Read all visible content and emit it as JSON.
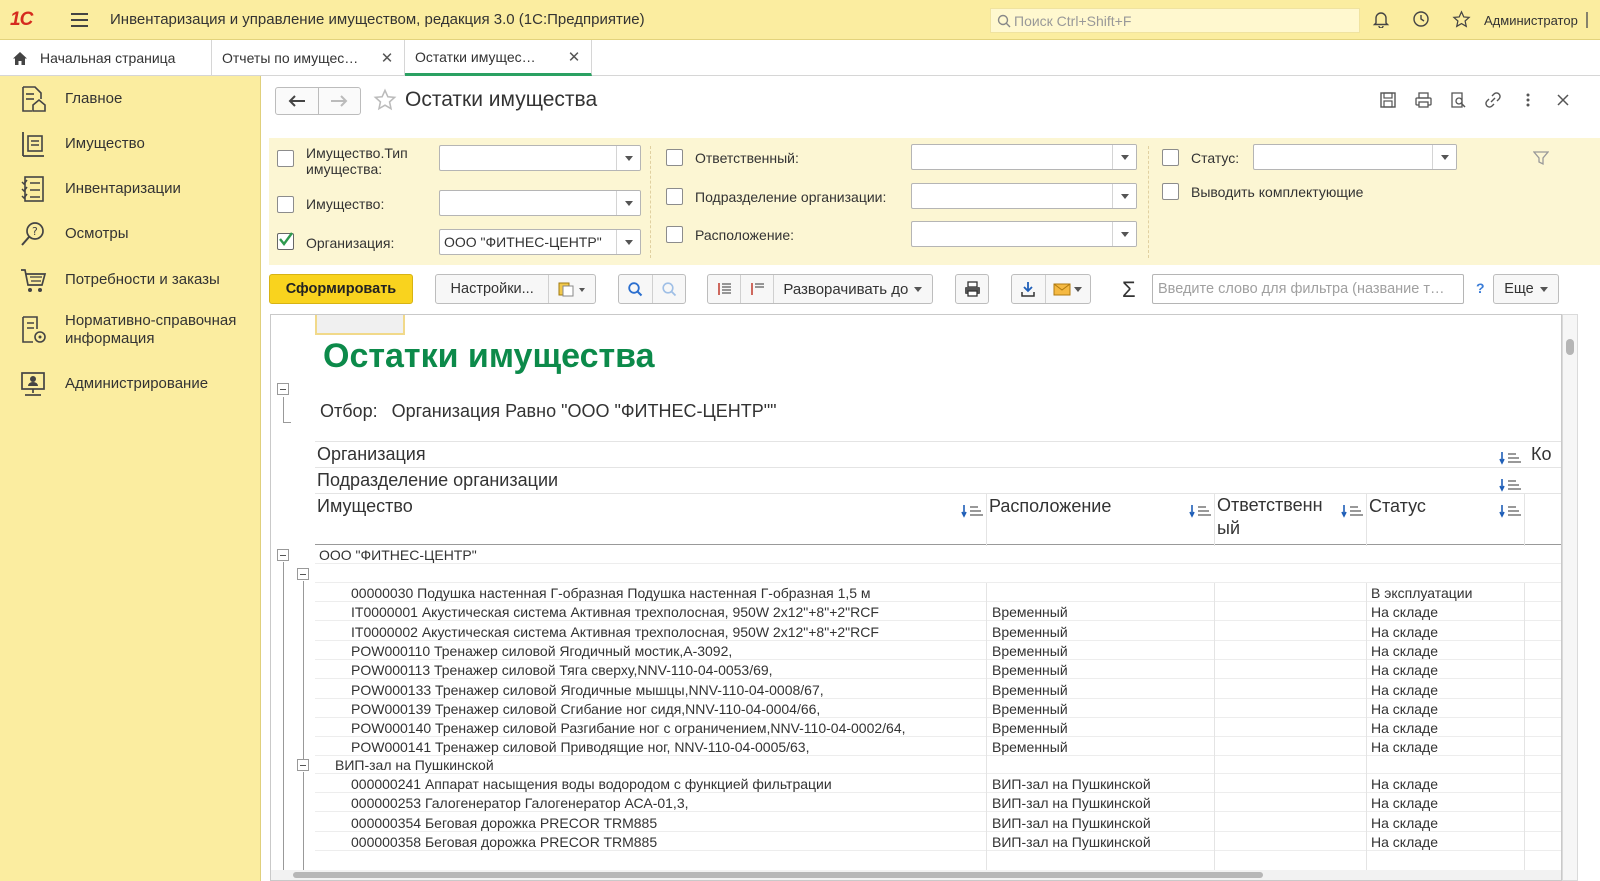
{
  "app": {
    "title": "Инвентаризация и управление имуществом, редакция 3.0  (1С:Предприятие)",
    "logo": "1С",
    "search_placeholder": "Поиск Ctrl+Shift+F",
    "user": "Администратор"
  },
  "tabs": [
    {
      "label": "Начальная страница"
    },
    {
      "label": "Отчеты по имущес…"
    },
    {
      "label": "Остатки имущес…"
    }
  ],
  "sidebar": {
    "items": [
      {
        "label": "Главное",
        "icon": "home-doc-icon"
      },
      {
        "label": "Имущество",
        "icon": "asset-icon"
      },
      {
        "label": "Инвентаризации",
        "icon": "checklist-icon"
      },
      {
        "label": "Осмотры",
        "icon": "inspection-icon"
      },
      {
        "label": "Потребности и заказы",
        "icon": "cart-icon"
      },
      {
        "label": "Нормативно-справочная информация",
        "icon": "reference-icon"
      },
      {
        "label": "Администрирование",
        "icon": "admin-icon"
      }
    ]
  },
  "form": {
    "title": "Остатки имущества"
  },
  "filters": {
    "property_type": {
      "label": "Имущество.Тип имущества:",
      "checked": false,
      "value": ""
    },
    "property": {
      "label": "Имущество:",
      "checked": false,
      "value": ""
    },
    "organization": {
      "label": "Организация:",
      "checked": true,
      "value": "ООО \"ФИТНЕС-ЦЕНТР\""
    },
    "responsible": {
      "label": "Ответственный:",
      "checked": false,
      "value": ""
    },
    "department": {
      "label": "Подразделение организации:",
      "checked": false,
      "value": ""
    },
    "location": {
      "label": "Расположение:",
      "checked": false,
      "value": ""
    },
    "status": {
      "label": "Статус:",
      "checked": false,
      "value": ""
    },
    "components": {
      "label": "Выводить комплектующие",
      "checked": false
    }
  },
  "toolbar": {
    "generate": "Сформировать",
    "settings": "Настройки...",
    "expand_to": "Разворачивать до",
    "filter_placeholder": "Введите слово для фильтра (название т…",
    "help": "?",
    "more": "Еще"
  },
  "report": {
    "title": "Остатки имущества",
    "filter_label": "Отбор:",
    "filter_value": "Организация Равно \"ООО \"ФИТНЕС-ЦЕНТР\"\"",
    "headers": {
      "org": "Организация",
      "dept": "Подразделение организации",
      "property": "Имущество",
      "location": "Расположение",
      "responsible_1": "Ответственн",
      "responsible_2": "ый",
      "status": "Статус",
      "extra": "Ко"
    },
    "group_org": "ООО \"ФИТНЕС-ЦЕНТР\"",
    "rows": [
      {
        "item": "00000030 Подушка настенная Г-образная Подушка настенная Г-образная 1,5 м",
        "location": "",
        "status": "В эксплуатации"
      },
      {
        "item": "IT0000001 Акустическая система Активная трехполосная, 950W 2x12\"+8\"+2\"RCF",
        "location": "Временный",
        "status": "На складе"
      },
      {
        "item": "IT0000002 Акустическая система Активная трехполосная, 950W 2x12\"+8\"+2\"RCF",
        "location": "Временный",
        "status": "На складе"
      },
      {
        "item": "POW000110 Тренажер силовой Ягодичный мостик,А-3092,",
        "location": "Временный",
        "status": "На складе"
      },
      {
        "item": "POW000113 Тренажер силовой Тяга сверху,NNV-110-04-0053/69,",
        "location": "Временный",
        "status": "На складе"
      },
      {
        "item": "POW000133 Тренажер силовой Ягодичные мышцы,NNV-110-04-0008/67,",
        "location": "Временный",
        "status": "На складе"
      },
      {
        "item": "POW000139 Тренажер силовой Сгибание ног сидя,NNV-110-04-0004/66,",
        "location": "Временный",
        "status": "На складе"
      },
      {
        "item": "POW000140 Тренажер силовой Разгибание ног с ограничением,NNV-110-04-0002/64,",
        "location": "Временный",
        "status": "На складе"
      },
      {
        "item": "POW000141 Тренажер силовой Приводящие ног, NNV-110-04-0005/63,",
        "location": "Временный",
        "status": "На складе"
      }
    ],
    "group_dept2": "ВИП-зал на Пушкинской",
    "rows2": [
      {
        "item": "000000241 Аппарат насыщения воды водородом с функцией фильтрации",
        "location": "ВИП-зал на Пушкинской",
        "status": "На складе"
      },
      {
        "item": "000000253 Галогенератор Галогенератор АСА-01,3,",
        "location": "ВИП-зал на Пушкинской",
        "status": "На складе"
      },
      {
        "item": "000000354 Беговая дорожка PRECOR TRM885",
        "location": "ВИП-зал на Пушкинской",
        "status": "На складе"
      },
      {
        "item": "000000358 Беговая дорожка PRECOR TRM885",
        "location": "ВИП-зал на Пушкинской",
        "status": "На складе"
      }
    ]
  },
  "colors": {
    "accent_yellow": "#fbeda0",
    "primary_button": "#f9d31e",
    "report_title": "#0c8a4a",
    "active_tab": "#2aa162"
  }
}
